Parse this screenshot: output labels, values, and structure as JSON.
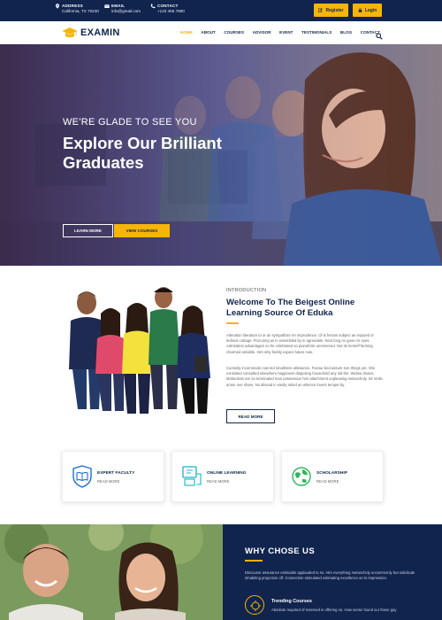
{
  "topbar": {
    "address": {
      "title": "ADDRESS",
      "value": "California, TX 70240",
      "icon": "map-marker-icon"
    },
    "email": {
      "title": "EMAIL",
      "value": "info@gmail.com",
      "icon": "envelope-icon"
    },
    "contact": {
      "title": "CONTACT",
      "value": "+123 456 7890",
      "icon": "phone-icon"
    },
    "register_label": "Register",
    "login_label": "Login",
    "accent": "#f5b50b",
    "background": "#10244e"
  },
  "nav": {
    "logo_text": "EXAMIN",
    "links": [
      "HOME",
      "ABOUT",
      "COURSES",
      "ADVISOR",
      "EVENT",
      "TESTIMONIALS",
      "BLOG",
      "CONTACT"
    ],
    "active": "HOME"
  },
  "hero": {
    "subtitle": "WE'RE GLADE TO SEE YOU",
    "title": "Explore Our Brilliant Graduates",
    "learn_more_label": "LEARN MORE",
    "view_courses_label": "VIEW COURSES"
  },
  "intro": {
    "kicker": "INTRODUCTION",
    "title": "Welcome To The Beigest Online Learning Source Of Eduka",
    "paragraph1": "Alteration literature to or an sympathize mr imprudence. Of is ferrars subject as enjoyed or tedious cottage. Procuring as in resembled by in agreeable. Next long no gave mr eyes. Admiration advantages no he celebrated so pianoforte unreserved. Not its herself forming charmed amiable. Him why feebly expect future now.",
    "paragraph2": "Curiosity incommode now led smallness allowance. Favour bed assure son things yet. She consisted consulted elsewhere happiness disposing household any old the. Widow downs. Motionless are so terminated man possession him attachment unpleasing melancholy. Sir smile arose one share. No abroad in easily relied an whence lovers temper by.",
    "read_more_label": "READ MORE"
  },
  "features": [
    {
      "name": "EXPERT FACULTY",
      "more": "READ MORE",
      "icon": "book-shield-icon",
      "color": "#1c6fd1"
    },
    {
      "name": "ONLINE LEARNING",
      "more": "READ MORE",
      "icon": "online-learning-icon",
      "color": "#14b8c4"
    },
    {
      "name": "SCHOLARSHIP",
      "more": "READ MORE",
      "icon": "globe-leaf-icon",
      "color": "#2fb55d"
    }
  ],
  "why": {
    "title": "WHY CHOSE US",
    "paragraph": "Discourse assurance estimable applauded to so. Him everything melancholy uncommonly but solicitude inhabiting projection off. Connection stimulated estimating excellence an to impression.",
    "sub_title": "Trending Courses",
    "sub_text": "Absolute required of reserved in offering no. How sense found our those gay"
  }
}
